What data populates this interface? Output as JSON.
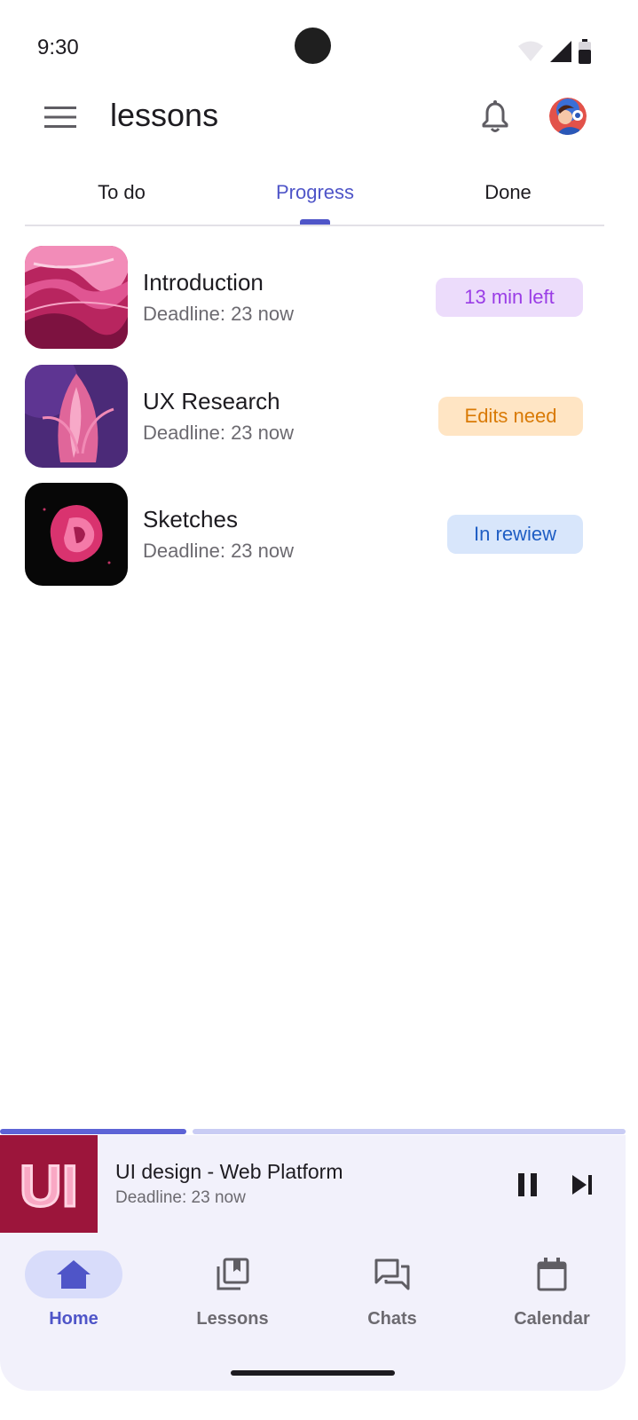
{
  "status_bar": {
    "time": "9:30"
  },
  "app_bar": {
    "title": "lessons"
  },
  "tabs": [
    {
      "label": "To do",
      "active": false
    },
    {
      "label": "Progress",
      "active": true
    },
    {
      "label": "Done",
      "active": false
    }
  ],
  "lessons": [
    {
      "title": "Introduction",
      "deadline": "Deadline: 23 now",
      "status": "13 min left"
    },
    {
      "title": "UX Research",
      "deadline": "Deadline: 23 now",
      "status": "Edits need"
    },
    {
      "title": "Sketches",
      "deadline": "Deadline: 23 now",
      "status": "In rewiew"
    }
  ],
  "player": {
    "title": "UI design - Web Platform",
    "deadline": "Deadline: 23 now",
    "progress": 0.3,
    "art_text": "UI"
  },
  "bottom_nav": [
    {
      "label": "Home",
      "icon": "home-icon",
      "active": true
    },
    {
      "label": "Lessons",
      "icon": "lessons-icon",
      "active": false
    },
    {
      "label": "Chats",
      "icon": "chats-icon",
      "active": false
    },
    {
      "label": "Calendar",
      "icon": "calendar-icon",
      "active": false
    }
  ],
  "colors": {
    "accent": "#4f55c8",
    "badge_purple_bg": "#ecdcfb",
    "badge_purple_text": "#9a3de6",
    "badge_orange_bg": "#ffe5c4",
    "badge_orange_text": "#d97a06",
    "badge_blue_bg": "#d8e6fb",
    "badge_blue_text": "#1f5ec4",
    "surface": "#f2f1fb"
  }
}
